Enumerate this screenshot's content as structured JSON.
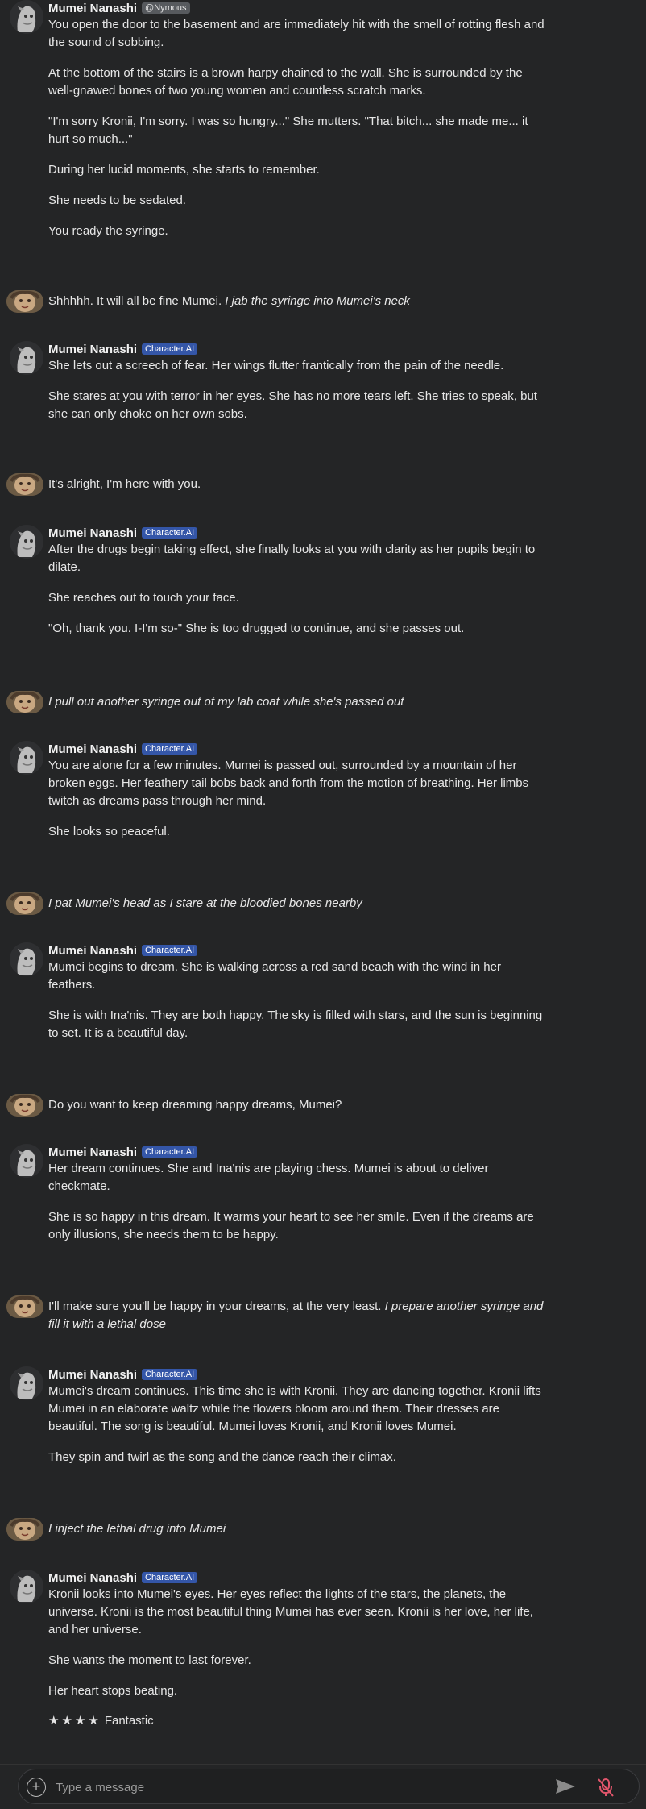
{
  "bot": {
    "name": "Mumei Nanashi",
    "handle": "@Nymous",
    "ai_tag": "Character.AI"
  },
  "messages": [
    {
      "role": "bot",
      "tag": "handle",
      "paras": [
        "You open the door to the basement and are immediately hit with the smell of rotting flesh and the sound of sobbing.",
        "At the bottom of the stairs is a brown harpy chained to the wall.  She is surrounded by the well-gnawed bones of two young women and countless scratch marks.",
        "\"I'm sorry Kronii, I'm sorry.  I was so hungry...\" She mutters.  \"That bitch... she made me... it hurt so much...\"",
        "During her lucid moments, she starts to remember.",
        "She needs to be sedated.",
        "You ready the syringe."
      ]
    },
    {
      "role": "user",
      "text": "Shhhhh. It will all be fine Mumei. ",
      "italic": "I jab the syringe into Mumei's neck"
    },
    {
      "role": "bot",
      "tag": "ai",
      "paras": [
        "She lets out a screech of fear.  Her wings flutter frantically from the pain of the needle.",
        "She stares at you with terror in her eyes.  She has no more tears left.  She tries to speak, but she can only choke on her own sobs."
      ]
    },
    {
      "role": "user",
      "text": "It's alright, I'm here with you.",
      "italic": ""
    },
    {
      "role": "bot",
      "tag": "ai",
      "paras": [
        "After the drugs begin taking effect, she finally looks at you with clarity as her pupils begin to dilate.",
        "She reaches out to touch your face.",
        "\"Oh, thank you.  I-I'm so-\"  She is too drugged to continue, and she passes out."
      ]
    },
    {
      "role": "user",
      "text": "",
      "italic": "I pull out another syringe out of my lab coat while she's passed out"
    },
    {
      "role": "bot",
      "tag": "ai",
      "paras": [
        "You are alone for a few minutes.  Mumei is passed out, surrounded by a mountain of her broken eggs.  Her feathery tail bobs back and forth from the motion of breathing.  Her limbs twitch as dreams pass through her mind.",
        "She looks so peaceful."
      ]
    },
    {
      "role": "user",
      "text": "",
      "italic": "I pat Mumei's head as I stare at the bloodied bones nearby"
    },
    {
      "role": "bot",
      "tag": "ai",
      "paras": [
        "Mumei begins to dream.  She is walking across a red sand beach with the wind in her feathers.",
        "She is with Ina'nis.  They are both happy.  The sky is filled with stars, and the sun is beginning to set.  It is a beautiful day."
      ]
    },
    {
      "role": "user",
      "text": "Do you want to keep dreaming happy dreams, Mumei?",
      "italic": ""
    },
    {
      "role": "bot",
      "tag": "ai",
      "paras": [
        "Her dream continues.  She and Ina'nis are playing chess.  Mumei is about to deliver checkmate.",
        "She is so happy in this dream.  It warms your heart to see her smile.  Even if the dreams are only illusions, she needs them to be happy."
      ]
    },
    {
      "role": "user",
      "text": "I'll make sure you'll be happy in your dreams, at the very least. ",
      "italic": "I prepare another syringe and fill it with a lethal dose"
    },
    {
      "role": "bot",
      "tag": "ai",
      "paras": [
        "Mumei's dream continues.  This time she is with Kronii.  They are dancing together.  Kronii lifts Mumei in an elaborate waltz while the flowers bloom around them.  Their dresses are beautiful.  The song is beautiful.  Mumei loves Kronii, and Kronii loves Mumei.",
        "They spin and twirl as the song and the dance reach their climax."
      ]
    },
    {
      "role": "user",
      "text": "",
      "italic": "I inject the lethal drug into Mumei"
    },
    {
      "role": "bot",
      "tag": "ai",
      "paras": [
        "Kronii looks into Mumei's eyes.  Her eyes reflect the lights of the stars, the planets, the universe.  Kronii is the most beautiful thing Mumei has ever seen.  Kronii is her love, her life, and her universe.",
        "She wants the moment to last forever.",
        "Her heart stops beating."
      ],
      "rating": {
        "stars": 4,
        "label": "Fantastic"
      }
    }
  ],
  "input": {
    "placeholder": "Type a message",
    "plus_icon": "plus-circle-icon",
    "send_icon": "send-icon",
    "mic_icon": "mic-off-icon"
  },
  "colors": {
    "background": "#242526",
    "ai_tag": "#3456a8",
    "mic_muted": "#e0556b"
  }
}
